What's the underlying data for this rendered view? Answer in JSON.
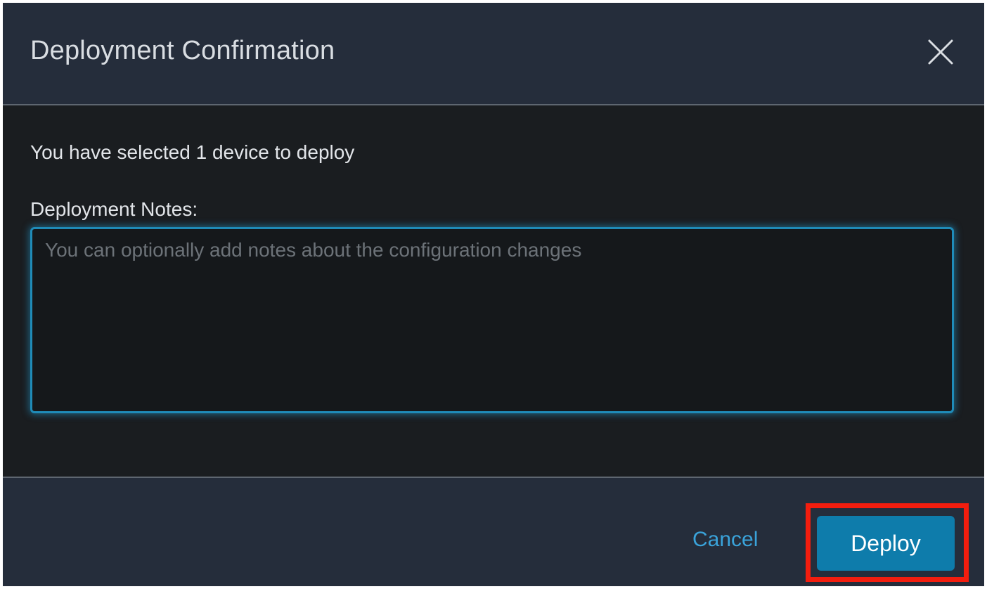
{
  "dialog": {
    "title": "Deployment Confirmation",
    "close_icon": "close-icon"
  },
  "body": {
    "selected_text": "You have selected 1 device to deploy",
    "notes_label": "Deployment Notes:",
    "notes_value": "",
    "notes_placeholder": "You can optionally add notes about the configuration changes"
  },
  "footer": {
    "cancel_label": "Cancel",
    "deploy_label": "Deploy"
  },
  "colors": {
    "header_footer_bg": "#252d3b",
    "body_bg": "#1a1d20",
    "accent": "#0e7cab",
    "link": "#3aa3da",
    "highlight": "#f31d0e"
  }
}
